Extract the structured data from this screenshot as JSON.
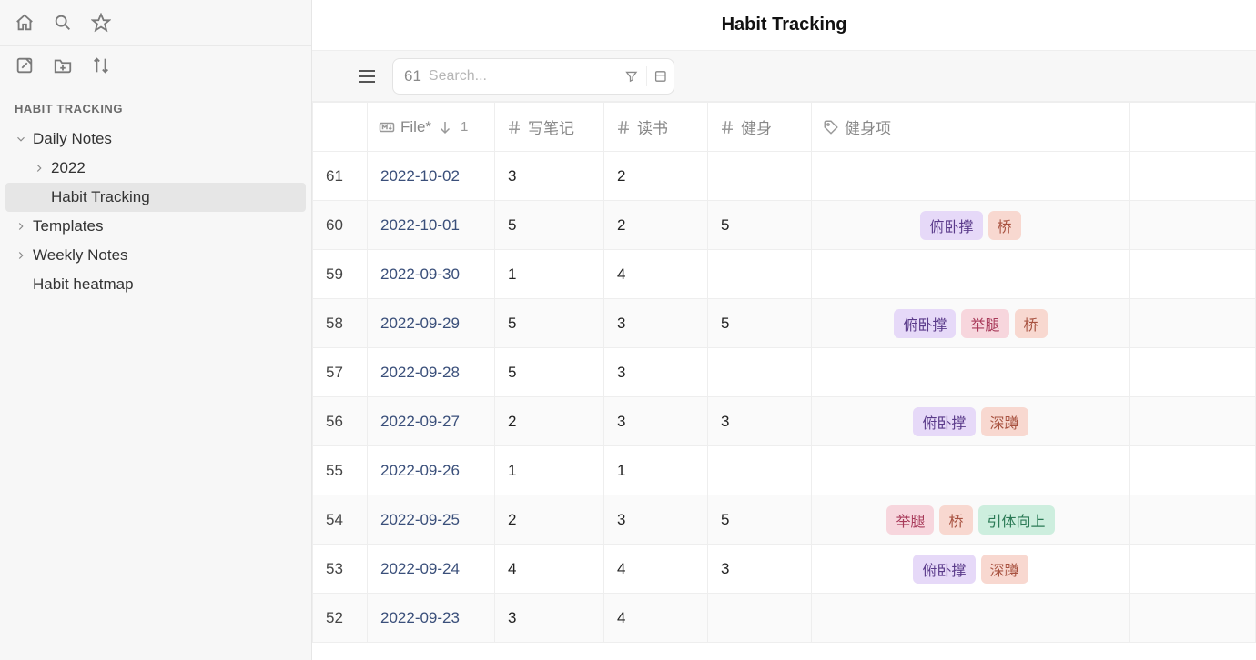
{
  "header": {
    "title": "Habit Tracking"
  },
  "sidebar": {
    "section_title": "HABIT TRACKING",
    "items": [
      {
        "label": "Daily Notes",
        "level": 0,
        "expandable": true,
        "expanded": true
      },
      {
        "label": "2022",
        "level": 1,
        "expandable": true,
        "expanded": false
      },
      {
        "label": "Habit Tracking",
        "level": 1,
        "expandable": false,
        "active": true
      },
      {
        "label": "Templates",
        "level": 0,
        "expandable": true,
        "expanded": false
      },
      {
        "label": "Weekly Notes",
        "level": 0,
        "expandable": true,
        "expanded": false
      },
      {
        "label": "Habit heatmap",
        "level": 0,
        "expandable": false
      }
    ]
  },
  "toolbar": {
    "result_count": "61",
    "search_placeholder": "Search..."
  },
  "columns": {
    "file_label": "File*",
    "sort_index": "1",
    "col2": "写笔记",
    "col3": "读书",
    "col4": "健身",
    "col5": "健身项"
  },
  "tags_palette": {
    "俯卧撑": "tag-purple",
    "桥": "tag-salmon",
    "举腿": "tag-pink",
    "深蹲": "tag-salmon",
    "引体向上": "tag-mint"
  },
  "rows": [
    {
      "idx": "61",
      "file": "2022-10-02",
      "c1": "3",
      "c2": "2",
      "c3": "",
      "tags": []
    },
    {
      "idx": "60",
      "file": "2022-10-01",
      "c1": "5",
      "c2": "2",
      "c3": "5",
      "tags": [
        "俯卧撑",
        "桥"
      ]
    },
    {
      "idx": "59",
      "file": "2022-09-30",
      "c1": "1",
      "c2": "4",
      "c3": "",
      "tags": []
    },
    {
      "idx": "58",
      "file": "2022-09-29",
      "c1": "5",
      "c2": "3",
      "c3": "5",
      "tags": [
        "俯卧撑",
        "举腿",
        "桥"
      ]
    },
    {
      "idx": "57",
      "file": "2022-09-28",
      "c1": "5",
      "c2": "3",
      "c3": "",
      "tags": []
    },
    {
      "idx": "56",
      "file": "2022-09-27",
      "c1": "2",
      "c2": "3",
      "c3": "3",
      "tags": [
        "俯卧撑",
        "深蹲"
      ]
    },
    {
      "idx": "55",
      "file": "2022-09-26",
      "c1": "1",
      "c2": "1",
      "c3": "",
      "tags": []
    },
    {
      "idx": "54",
      "file": "2022-09-25",
      "c1": "2",
      "c2": "3",
      "c3": "5",
      "tags": [
        "举腿",
        "桥",
        "引体向上"
      ]
    },
    {
      "idx": "53",
      "file": "2022-09-24",
      "c1": "4",
      "c2": "4",
      "c3": "3",
      "tags": [
        "俯卧撑",
        "深蹲"
      ]
    },
    {
      "idx": "52",
      "file": "2022-09-23",
      "c1": "3",
      "c2": "4",
      "c3": "",
      "tags": []
    }
  ]
}
